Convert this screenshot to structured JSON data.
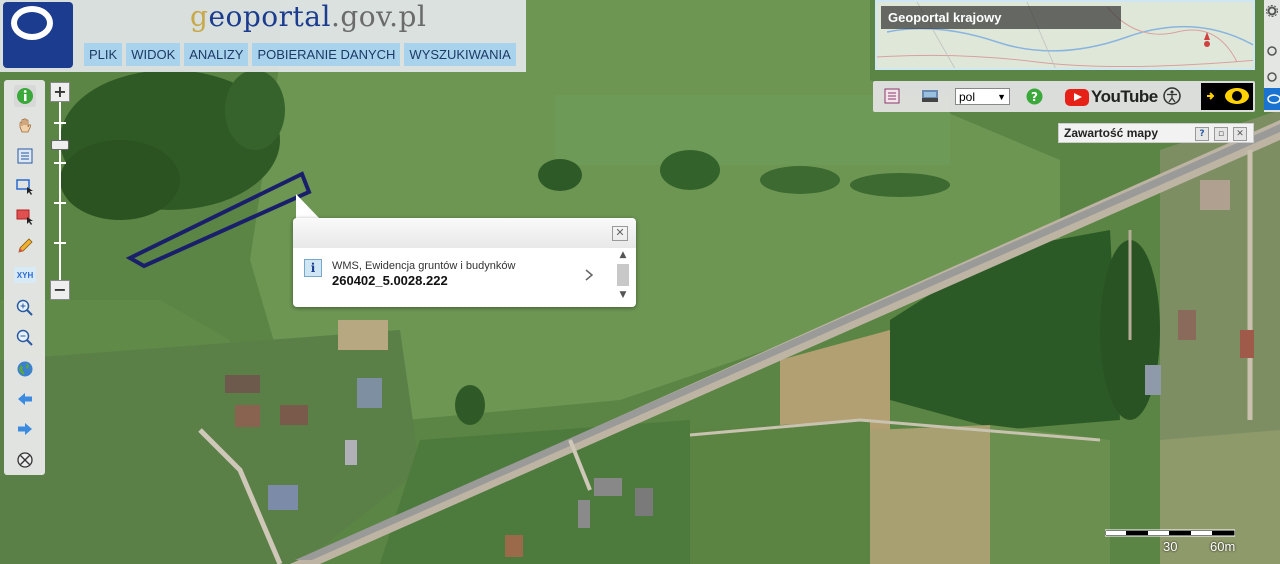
{
  "header": {
    "site_title_first": "g",
    "site_title_mid": "eoportal",
    "site_title_rest": ".gov.pl",
    "logo_letter": "g",
    "menu": [
      "PLIK",
      "WIDOK",
      "ANALIZY",
      "POBIERANIE DANYCH",
      "WYSZUKIWANIA"
    ]
  },
  "toolbar": {
    "xyh_label": "XYH",
    "tools": [
      "info-icon",
      "pan-hand-icon",
      "legend-icon",
      "select-rectangle-icon",
      "select-remove-icon",
      "measure-pencil-icon",
      "xyh-icon",
      "zoom-in-icon",
      "zoom-out-icon",
      "globe-icon",
      "back-arrow-icon",
      "forward-arrow-icon",
      "clear-icon"
    ]
  },
  "zoom": {
    "plus": "+",
    "minus": "−"
  },
  "popup": {
    "layer_name": "WMS, Ewidencja gruntów i budynków",
    "parcel_id": "260402_5.0028.222",
    "close": "✕",
    "info_letter": "i"
  },
  "overview": {
    "label": "Geoportal krajowy"
  },
  "right_toolbar": {
    "language": "pol",
    "youtube_label": "YouTube",
    "help": "?"
  },
  "map_contents": {
    "title": "Zawartość mapy",
    "help": "?",
    "close": "✕"
  },
  "scale": {
    "mid_label": "30",
    "end_label": "60m"
  },
  "colors": {
    "menu_bg": "#a9d3ec",
    "parcel_outline": "#1a1f6b",
    "logo_bg": "#1b3c8f"
  }
}
